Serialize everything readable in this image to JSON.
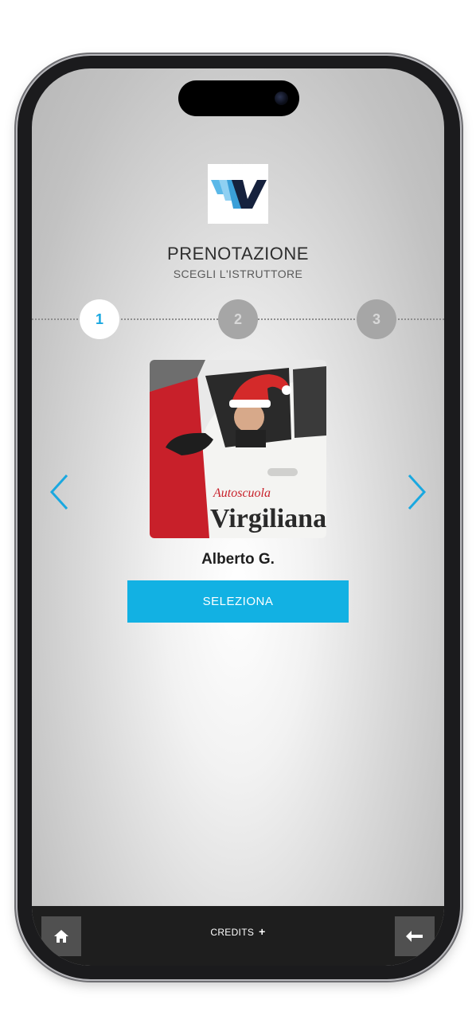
{
  "header": {
    "title": "PRENOTAZIONE",
    "subtitle": "SCEGLI L'ISTRUTTORE"
  },
  "stepper": {
    "steps": [
      {
        "label": "1",
        "state": "active"
      },
      {
        "label": "2",
        "state": "inactive"
      },
      {
        "label": "3",
        "state": "inactive"
      }
    ]
  },
  "instructor": {
    "name": "Alberto G.",
    "car_text_line1": "Autoscuola",
    "car_text_line2": "Virgiliana"
  },
  "actions": {
    "select_label": "SELEZIONA"
  },
  "bottom_bar": {
    "credits_label": "CREDITS",
    "credits_icon": "+",
    "home_icon": "home-icon",
    "back_icon": "back-arrow-icon"
  },
  "colors": {
    "accent": "#12b1e3",
    "bar": "#1e1e1e",
    "step_active_text": "#1aa8e0"
  }
}
